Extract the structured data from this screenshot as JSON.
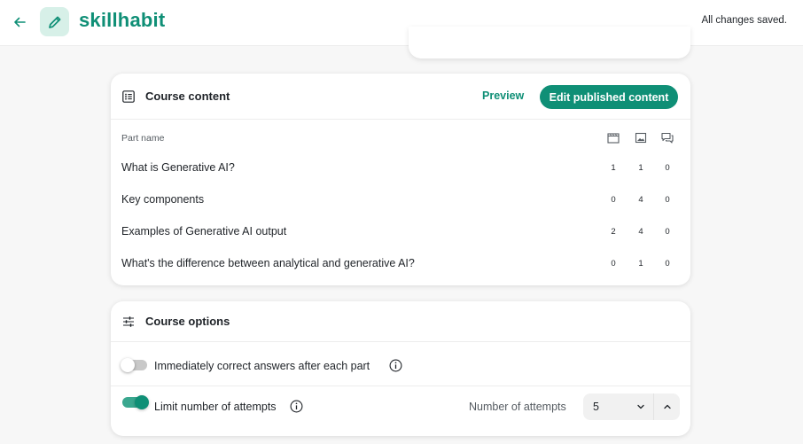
{
  "header": {
    "brand": "skillhabit",
    "status": "All changes saved."
  },
  "content_card": {
    "title": "Course content",
    "preview_label": "Preview",
    "edit_label": "Edit published content",
    "column_part_name": "Part name",
    "column_icons": [
      "film-icon",
      "image-icon",
      "chat-icon"
    ],
    "rows": [
      {
        "name": "What is Generative AI?",
        "videos": "1",
        "images": "1",
        "discussions": "0"
      },
      {
        "name": "Key components",
        "videos": "0",
        "images": "4",
        "discussions": "0"
      },
      {
        "name": "Examples of Generative AI output",
        "videos": "2",
        "images": "4",
        "discussions": "0"
      },
      {
        "name": "What's the difference between analytical and generative AI?",
        "videos": "0",
        "images": "1",
        "discussions": "0"
      }
    ]
  },
  "options_card": {
    "title": "Course options",
    "immediate_correct": {
      "label": "Immediately correct answers after each part",
      "enabled": false
    },
    "limit_attempts": {
      "label": "Limit number of attempts",
      "enabled": true
    },
    "attempts_label": "Number of attempts",
    "attempts_value": "5"
  },
  "colors": {
    "accent": "#0f8f76",
    "accent_light": "#d7f0e8",
    "background": "#f7f7f7"
  }
}
